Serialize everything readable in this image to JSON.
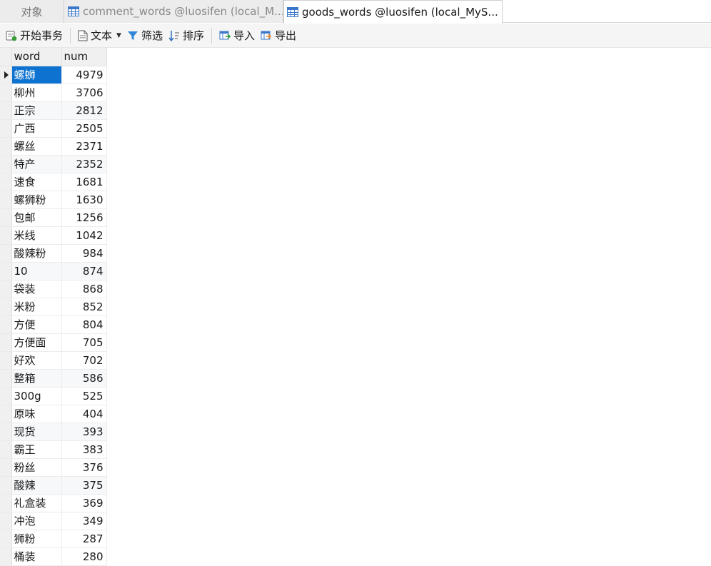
{
  "tabs": {
    "objects": "对象",
    "comment": "comment_words @luosifen (local_M...",
    "goods": "goods_words @luosifen (local_MyS..."
  },
  "toolbar": {
    "begin_transaction": "开始事务",
    "text": "文本",
    "filter": "筛选",
    "sort": "排序",
    "import": "导入",
    "export": "导出"
  },
  "grid": {
    "columns": [
      "word",
      "num"
    ],
    "rows": [
      {
        "word": "螺蛳",
        "num": "4979"
      },
      {
        "word": "柳州",
        "num": "3706"
      },
      {
        "word": "正宗",
        "num": "2812"
      },
      {
        "word": "广西",
        "num": "2505"
      },
      {
        "word": "螺丝",
        "num": "2371"
      },
      {
        "word": "特产",
        "num": "2352"
      },
      {
        "word": "速食",
        "num": "1681"
      },
      {
        "word": "螺狮粉",
        "num": "1630"
      },
      {
        "word": "包邮",
        "num": "1256"
      },
      {
        "word": "米线",
        "num": "1042"
      },
      {
        "word": "酸辣粉",
        "num": "984"
      },
      {
        "word": "10",
        "num": "874"
      },
      {
        "word": "袋装",
        "num": "868"
      },
      {
        "word": "米粉",
        "num": "852"
      },
      {
        "word": "方便",
        "num": "804"
      },
      {
        "word": "方便面",
        "num": "705"
      },
      {
        "word": "好欢",
        "num": "702"
      },
      {
        "word": "整箱",
        "num": "586"
      },
      {
        "word": "300g",
        "num": "525"
      },
      {
        "word": "原味",
        "num": "404"
      },
      {
        "word": "现货",
        "num": "393"
      },
      {
        "word": "霸王",
        "num": "383"
      },
      {
        "word": "粉丝",
        "num": "376"
      },
      {
        "word": "酸辣",
        "num": "375"
      },
      {
        "word": "礼盒装",
        "num": "369"
      },
      {
        "word": "冲泡",
        "num": "349"
      },
      {
        "word": "狮粉",
        "num": "287"
      },
      {
        "word": "桶装",
        "num": "280"
      }
    ]
  },
  "colors": {
    "selection": "#0e72d1",
    "accent": "#1f7fd6"
  },
  "icons": [
    "table-icon",
    "transaction-icon",
    "document-icon",
    "filter-icon",
    "sort-icon",
    "import-icon",
    "export-icon",
    "row-indicator-arrow-icon"
  ]
}
